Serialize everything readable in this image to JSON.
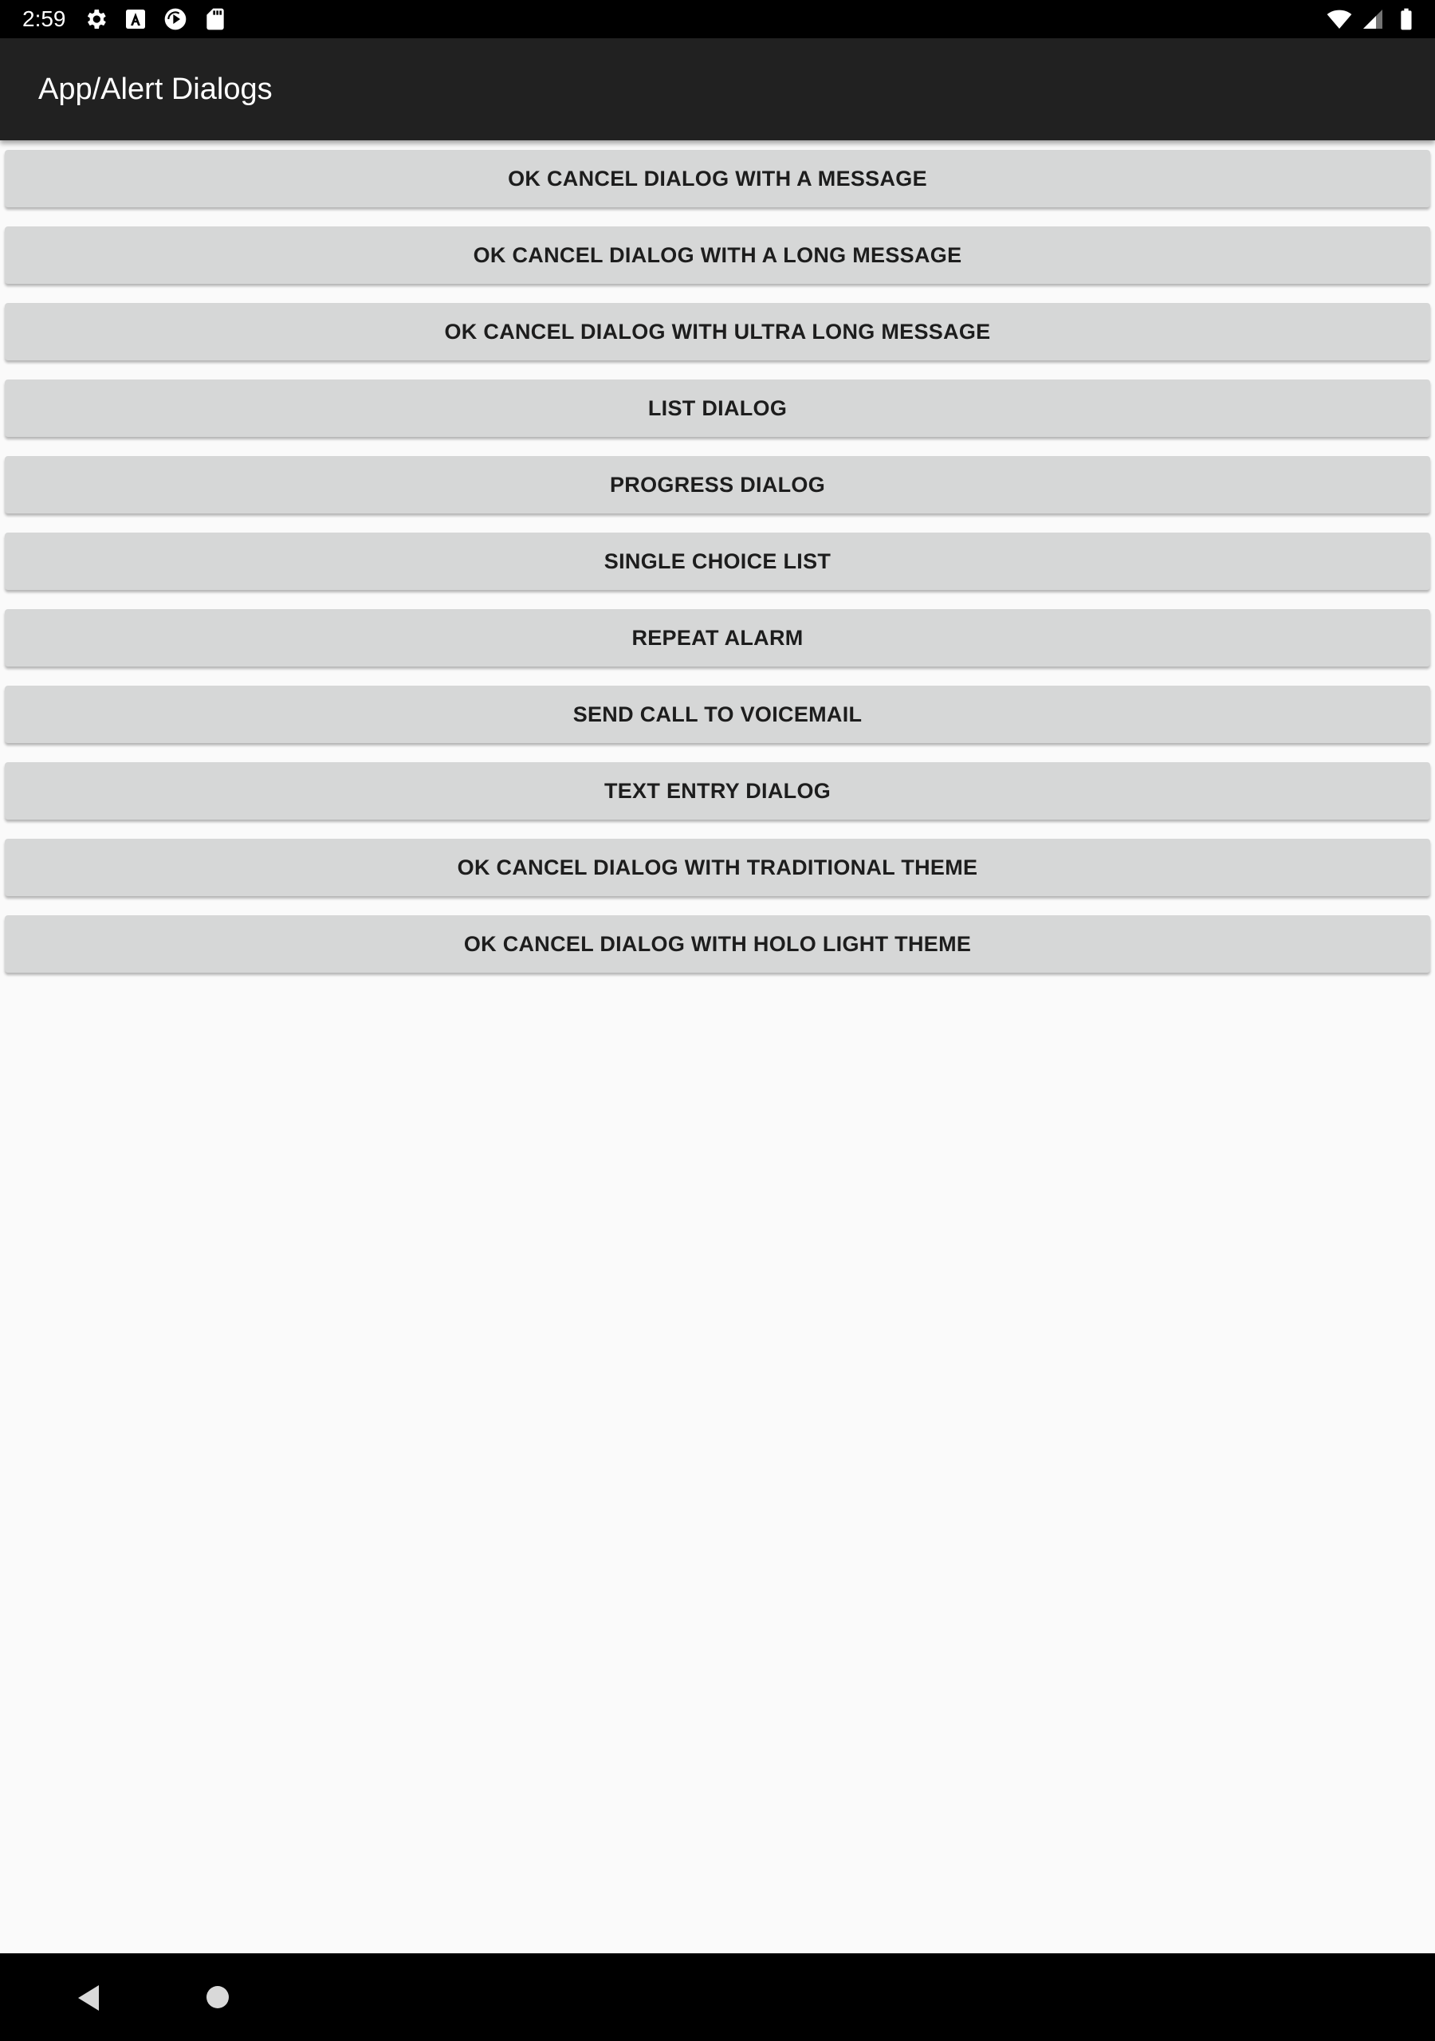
{
  "status_bar": {
    "time": "2:59",
    "left_icons": [
      "settings-gear-icon",
      "font-a-icon",
      "sync-play-icon",
      "sd-card-icon"
    ],
    "right_icons": [
      "wifi-icon",
      "cell-signal-icon",
      "battery-icon"
    ]
  },
  "app_bar": {
    "title": "App/Alert Dialogs",
    "background": "#212121"
  },
  "buttons": [
    {
      "label": "OK CANCEL DIALOG WITH A MESSAGE"
    },
    {
      "label": "OK CANCEL DIALOG WITH A LONG MESSAGE"
    },
    {
      "label": "OK CANCEL DIALOG WITH ULTRA LONG MESSAGE"
    },
    {
      "label": "LIST DIALOG"
    },
    {
      "label": "PROGRESS DIALOG"
    },
    {
      "label": "SINGLE CHOICE LIST"
    },
    {
      "label": "REPEAT ALARM"
    },
    {
      "label": "SEND CALL TO VOICEMAIL"
    },
    {
      "label": "TEXT ENTRY DIALOG"
    },
    {
      "label": "OK CANCEL DIALOG WITH TRADITIONAL THEME"
    },
    {
      "label": "OK CANCEL DIALOG WITH HOLO LIGHT THEME"
    }
  ],
  "nav_bar": {
    "icons": [
      "back-icon",
      "home-icon"
    ]
  },
  "colors": {
    "button_background": "#d6d7d7",
    "page_background": "#fafafa",
    "bar_background": "#000000"
  }
}
